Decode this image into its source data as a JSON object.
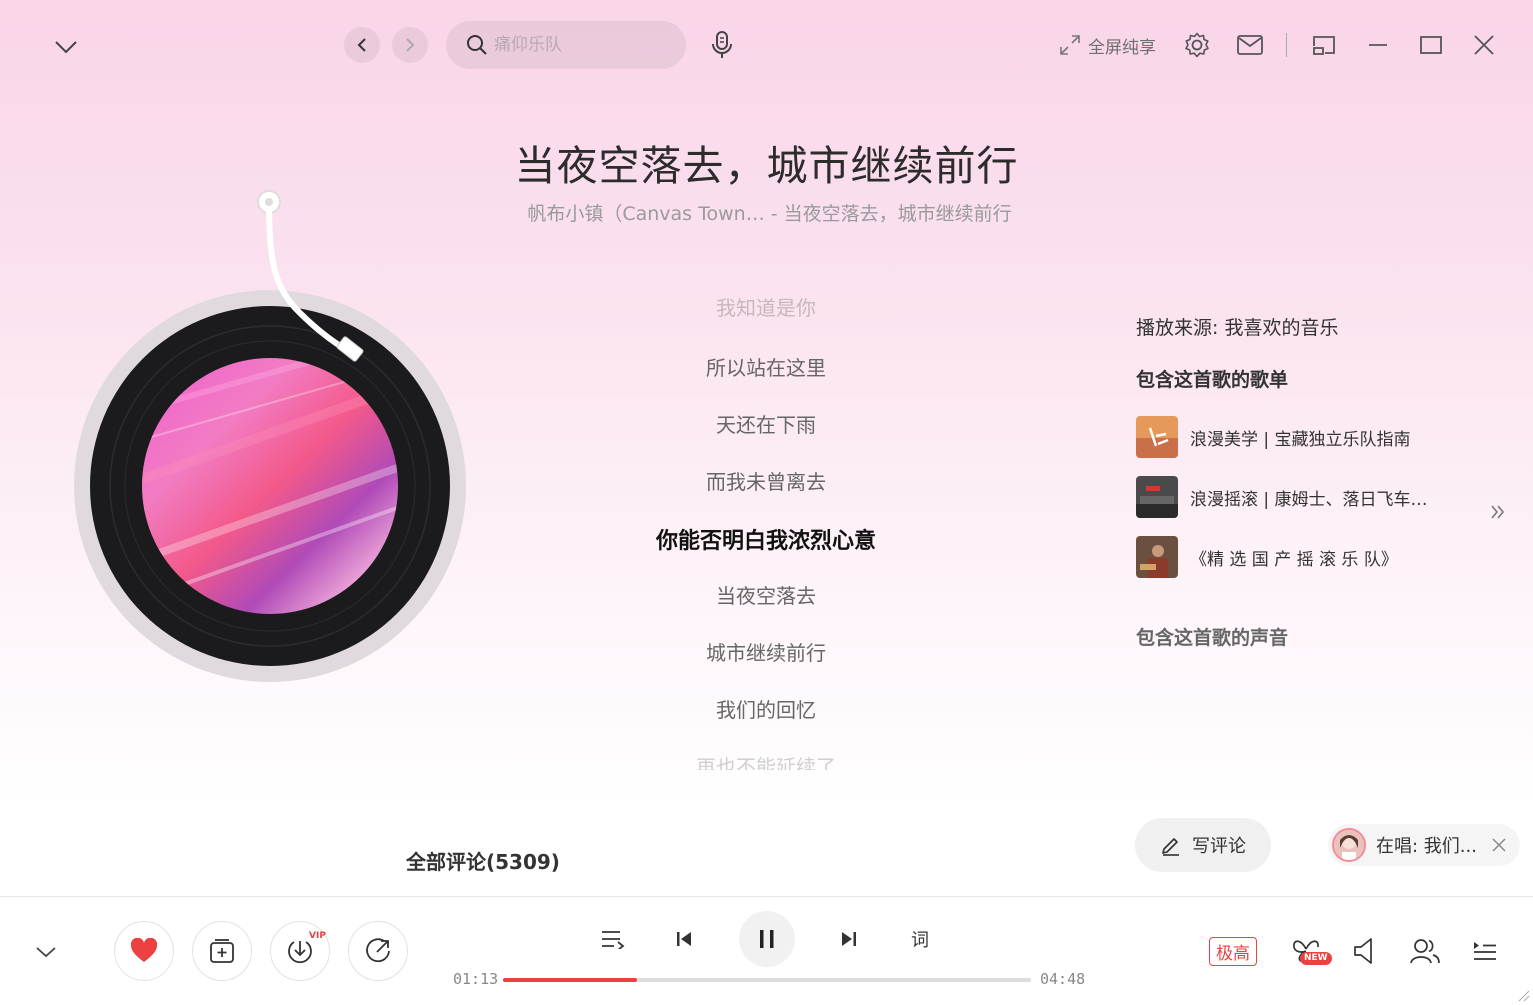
{
  "topbar": {
    "search_placeholder": "痛仰乐队",
    "fullscreen_label": "全屏纯享"
  },
  "song": {
    "title": "当夜空落去，城市继续前行",
    "subtitle": "帆布小镇（Canvas Town… - 当夜空落去，城市继续前行"
  },
  "lyrics": [
    "我知道是你",
    "所以站在这里",
    "天还在下雨",
    "而我未曾离去",
    "你能否明白我浓烈心意",
    "当夜空落去",
    "城市继续前行",
    "我们的回忆",
    "再也不能延续了"
  ],
  "active_lyric_index": 4,
  "right_panel": {
    "source": "播放来源: 我喜欢的音乐",
    "playlists_title": "包含这首歌的歌单",
    "playlists": [
      {
        "name": "浪漫美学 | 宝藏独立乐队指南"
      },
      {
        "name": "浪漫摇滚 | 康姆士、落日飞车…"
      },
      {
        "name": "《精 选 国 产 摇 滚 乐 队》"
      }
    ],
    "voices_title": "包含这首歌的声音"
  },
  "comments": {
    "title": "全部评论(5309)",
    "write_label": "写评论",
    "singing_label": "在唱: 我们..."
  },
  "player": {
    "elapsed": "01:13",
    "duration": "04:48",
    "progress": 0.253,
    "lyric_button": "词",
    "quality": "极高",
    "vip_badge": "VIP",
    "new_badge": "NEW",
    "liked": true
  },
  "colors": {
    "accent": "#ec4141",
    "active_lyric": "#111111"
  }
}
